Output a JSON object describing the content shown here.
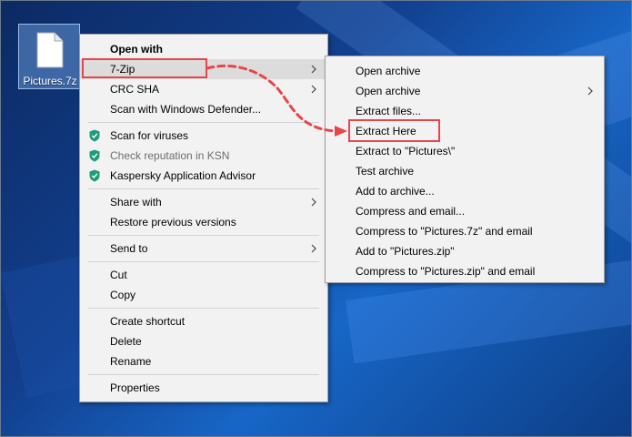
{
  "desktop": {
    "file_label": "Pictures.7z"
  },
  "context_menu": {
    "items": [
      {
        "label": "Open with"
      },
      {
        "label": "7-Zip"
      },
      {
        "label": "CRC SHA"
      },
      {
        "label": "Scan with Windows Defender..."
      },
      {
        "label": "Scan for viruses"
      },
      {
        "label": "Check reputation in KSN"
      },
      {
        "label": "Kaspersky Application Advisor"
      },
      {
        "label": "Share with"
      },
      {
        "label": "Restore previous versions"
      },
      {
        "label": "Send to"
      },
      {
        "label": "Cut"
      },
      {
        "label": "Copy"
      },
      {
        "label": "Create shortcut"
      },
      {
        "label": "Delete"
      },
      {
        "label": "Rename"
      },
      {
        "label": "Properties"
      }
    ]
  },
  "submenu_7zip": {
    "items": [
      {
        "label": "Open archive"
      },
      {
        "label": "Open archive"
      },
      {
        "label": "Extract files..."
      },
      {
        "label": "Extract Here"
      },
      {
        "label": "Extract to \"Pictures\\\""
      },
      {
        "label": "Test archive"
      },
      {
        "label": "Add to archive..."
      },
      {
        "label": "Compress and email..."
      },
      {
        "label": "Compress to \"Pictures.7z\" and email"
      },
      {
        "label": "Add to \"Pictures.zip\""
      },
      {
        "label": "Compress to \"Pictures.zip\" and email"
      }
    ]
  },
  "colors": {
    "highlight": "#e8454a",
    "kaspersky_shield": "#1f9c7a",
    "menu_background": "#f2f2f2",
    "hover_background": "#dcdcdc"
  },
  "icons": [
    "file-icon",
    "chevron-right-icon",
    "kaspersky-shield-icon"
  ]
}
